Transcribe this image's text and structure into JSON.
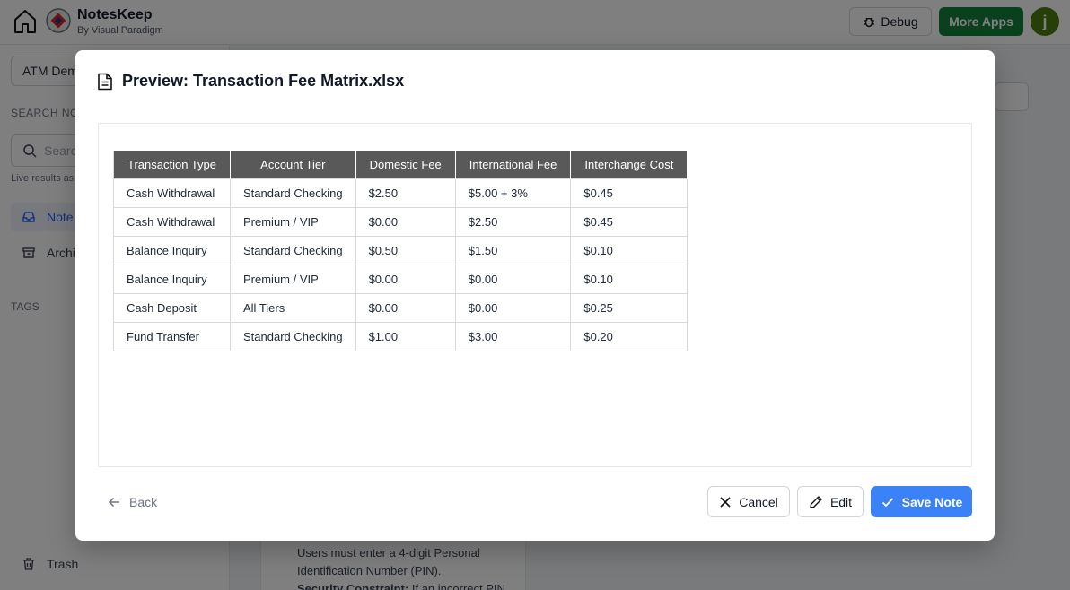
{
  "app": {
    "name": "NotesKeep",
    "subtitle": "By Visual Paradigm",
    "debug_label": "Debug",
    "more_apps_label": "More Apps",
    "avatar_initial": "j"
  },
  "sidebar": {
    "notebook": "ATM Dem",
    "search_label": "SEARCH NOT",
    "search_placeholder": "Searc",
    "live_hint": "Live results as",
    "nav_notes": "Note",
    "nav_archive": "Archi",
    "tags_label": "TAGS",
    "trash_label": "Trash"
  },
  "background_note": {
    "line1": "Users must enter a 4-digit Personal",
    "line2": "Identification Number (PIN).",
    "line3_bold": "Security Constraint:",
    "line3_rest": " If an incorrect PIN"
  },
  "modal": {
    "title": "Preview: Transaction Fee Matrix.xlsx",
    "back_label": "Back",
    "cancel_label": "Cancel",
    "edit_label": "Edit",
    "save_label": "Save Note"
  },
  "table": {
    "headers": [
      "Transaction Type",
      "Account Tier",
      "Domestic Fee",
      "International Fee",
      "Interchange Cost"
    ],
    "rows": [
      [
        "Cash Withdrawal",
        "Standard Checking",
        "$2.50",
        "$5.00 + 3%",
        "$0.45"
      ],
      [
        "Cash Withdrawal",
        "Premium / VIP",
        "$0.00",
        "$2.50",
        "$0.45"
      ],
      [
        "Balance Inquiry",
        "Standard Checking",
        "$0.50",
        "$1.50",
        "$0.10"
      ],
      [
        "Balance Inquiry",
        "Premium / VIP",
        "$0.00",
        "$0.00",
        "$0.10"
      ],
      [
        "Cash Deposit",
        "All Tiers",
        "$0.00",
        "$0.00",
        "$0.25"
      ],
      [
        "Fund Transfer",
        "Standard Checking",
        "$1.00",
        "$3.00",
        "$0.20"
      ]
    ]
  },
  "colors": {
    "header_bg": "#595959",
    "primary": "#3b82f6",
    "more_apps": "#15803d"
  }
}
